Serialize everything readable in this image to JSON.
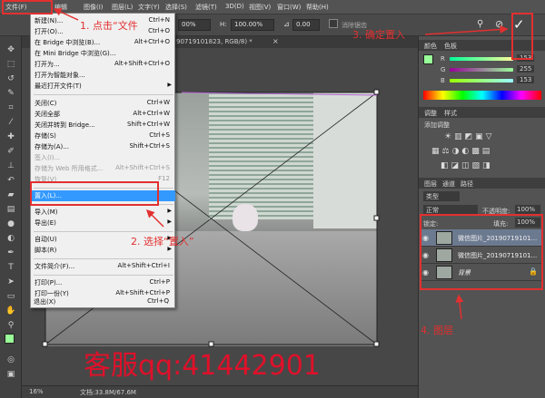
{
  "menubar": {
    "items": [
      "文件(F)",
      "编辑",
      "图像(I)",
      "图层(L)",
      "文字(Y)",
      "选择(S)",
      "滤镜(T)",
      "3D(D)",
      "视图(V)",
      "窗口(W)",
      "帮助(H)"
    ]
  },
  "options": {
    "w_value": "00%",
    "h_label": "H:",
    "h_value": "100.00%",
    "angle": "0.00",
    "antialias": "消除锯齿"
  },
  "document_tab": {
    "title": "90719101823, RGB/8) *"
  },
  "file_menu": {
    "items": [
      {
        "label": "新建(N)...",
        "shortcut": "Ctrl+N",
        "enabled": true
      },
      {
        "label": "打开(O)...",
        "shortcut": "Ctrl+O",
        "enabled": true
      },
      {
        "label": "在 Bridge 中浏览(B)...",
        "shortcut": "Alt+Ctrl+O",
        "enabled": true
      },
      {
        "label": "在 Mini Bridge 中浏览(G)...",
        "shortcut": "",
        "enabled": true
      },
      {
        "label": "打开为...",
        "shortcut": "Alt+Shift+Ctrl+O",
        "enabled": true
      },
      {
        "label": "打开为智能对象...",
        "shortcut": "",
        "enabled": true
      },
      {
        "label": "最近打开文件(T)",
        "shortcut": "",
        "enabled": true,
        "submenu": true
      },
      {
        "label": "关闭(C)",
        "shortcut": "Ctrl+W",
        "enabled": true
      },
      {
        "label": "关闭全部",
        "shortcut": "Alt+Ctrl+W",
        "enabled": true
      },
      {
        "label": "关闭并转到 Bridge...",
        "shortcut": "Shift+Ctrl+W",
        "enabled": true
      },
      {
        "label": "存储(S)",
        "shortcut": "Ctrl+S",
        "enabled": true
      },
      {
        "label": "存储为(A)...",
        "shortcut": "Shift+Ctrl+S",
        "enabled": true
      },
      {
        "label": "签入(I)...",
        "shortcut": "",
        "enabled": false
      },
      {
        "label": "存储为 Web 所用格式...",
        "shortcut": "Alt+Shift+Ctrl+S",
        "enabled": false
      },
      {
        "label": "恢复(V)",
        "shortcut": "F12",
        "enabled": false
      },
      {
        "label": "置入(L)...",
        "shortcut": "",
        "enabled": true,
        "highlighted": true
      },
      {
        "label": "导入(M)",
        "shortcut": "",
        "enabled": true,
        "submenu": true
      },
      {
        "label": "导出(E)",
        "shortcut": "",
        "enabled": true,
        "submenu": true
      },
      {
        "label": "自动(U)",
        "shortcut": "",
        "enabled": true,
        "submenu": true
      },
      {
        "label": "脚本(R)",
        "shortcut": "",
        "enabled": true,
        "submenu": true
      },
      {
        "label": "文件简介(F)...",
        "shortcut": "Alt+Shift+Ctrl+I",
        "enabled": true
      },
      {
        "label": "打印(P)...",
        "shortcut": "Ctrl+P",
        "enabled": true
      },
      {
        "label": "打印一份(Y)",
        "shortcut": "Alt+Shift+Ctrl+P",
        "enabled": true
      },
      {
        "label": "退出(X)",
        "shortcut": "Ctrl+Q",
        "enabled": true
      }
    ]
  },
  "panels": {
    "color_tab": "颜色",
    "swatches_tab": "色板",
    "color_values": {
      "r": "153",
      "g": "255",
      "b": "153"
    },
    "adjust_tab": "调整",
    "styles_tab": "样式",
    "adjust_title": "添加调整",
    "layers_tab": "图层",
    "channels_tab": "通道",
    "paths_tab": "路径",
    "kind_filter": "类型",
    "blend_mode": "正常",
    "opacity_label": "不透明度:",
    "opacity_value": "100%",
    "lock_label": "锁定:",
    "fill_label": "填充:",
    "fill_value": "100%",
    "layers": [
      {
        "name": "微信图片_20190719101...",
        "selected": true
      },
      {
        "name": "微信图片_20190719101...",
        "selected": false
      },
      {
        "name": "背景",
        "selected": false,
        "locked": true
      }
    ]
  },
  "status": {
    "zoom": "16%",
    "doc_size": "文档:33.8M/67.6M"
  },
  "annotations": {
    "step1": "1. 点击“文件",
    "step2": "2. 选择“置入”",
    "step3": "3. 确定置入",
    "step4": "4. 图层"
  },
  "watermark": "客服qq:41442901",
  "colors": {
    "annotation_red": "#e23030",
    "menu_highlight": "#3399ff",
    "foreground_swatch": "#99ff99"
  }
}
